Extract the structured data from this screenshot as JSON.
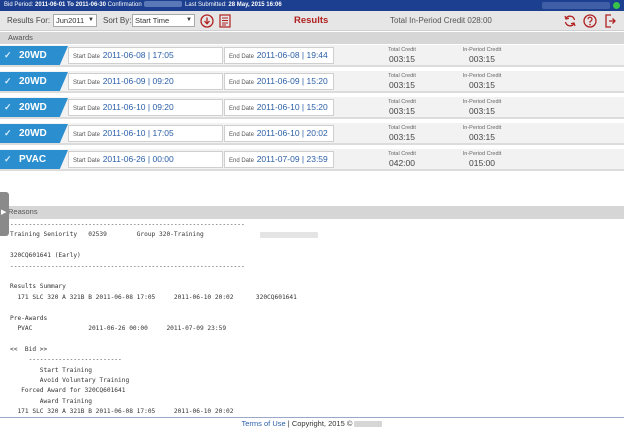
{
  "topbar": {
    "bid_period_label": "Bid Period:",
    "bid_period_value": "2011-06-01 To 2011-06-30",
    "confirmation_label": "Confirmation",
    "last_submitted_label": "Last Submitted:",
    "last_submitted_value": "28 May, 2015 16:06"
  },
  "toolbar": {
    "results_for_label": "Results For:",
    "results_for_value": "Jun2011",
    "sort_by_label": "Sort By:",
    "sort_by_value": "Start Time",
    "title": "Results",
    "total_credit": "Total In-Period Credit 028:00"
  },
  "awards_header": "Awards",
  "award_labels": {
    "start": "Start Date",
    "end": "End Date",
    "total_credit": "Total Credit",
    "in_period_credit": "In-Period Credit"
  },
  "awards": [
    {
      "code": "20WD",
      "start": "2011-06-08 | 17:05",
      "end": "2011-06-08 | 19:44",
      "total": "003:15",
      "in_period": "003:15"
    },
    {
      "code": "20WD",
      "start": "2011-06-09 | 09:20",
      "end": "2011-06-09 | 15:20",
      "total": "003:15",
      "in_period": "003:15"
    },
    {
      "code": "20WD",
      "start": "2011-06-10 | 09:20",
      "end": "2011-06-10 | 15:20",
      "total": "003:15",
      "in_period": "003:15"
    },
    {
      "code": "20WD",
      "start": "2011-06-10 | 17:05",
      "end": "2011-06-10 | 20:02",
      "total": "003:15",
      "in_period": "003:15"
    },
    {
      "code": "PVAC",
      "start": "2011-06-26 | 00:00",
      "end": "2011-07-09 | 23:59",
      "total": "042:00",
      "in_period": "015:00"
    }
  ],
  "reasons_header": "Reasons",
  "reasons_lines": [
    "---------------------------------------------------------------",
    "Training Seniority   02539        Group 320-Training",
    "",
    "320CQ601641 (Early)",
    "---------------------------------------------------------------",
    "",
    "Results Summary",
    "  171 SLC 320 A 321B B 2011-06-08 17:05     2011-06-10 20:02      320CQ601641",
    "",
    "Pre-Awards",
    "  PVAC               2011-06-26 00:00     2011-07-09 23:59",
    "",
    "<<  Bid >>",
    "     -------------------------",
    "        Start Training",
    "        Avoid Voluntary Training",
    "   Forced Award for 320CQ601641",
    "        Award Training",
    "  171 SLC 320 A 321B B 2011-06-08 17:05     2011-06-10 20:02"
  ],
  "footer": {
    "terms": "Terms of Use",
    "copyright": "| Copyright, 2015 ©"
  },
  "icons": {
    "download": "download-icon",
    "report": "report-icon",
    "refresh": "refresh-icon",
    "help": "help-icon",
    "logout": "logout-icon"
  },
  "colors": {
    "topbar": "#1c3f8f",
    "accent_red": "#b02020",
    "award_tag": "#2b8fcf",
    "status_dot": "#37c24a"
  }
}
